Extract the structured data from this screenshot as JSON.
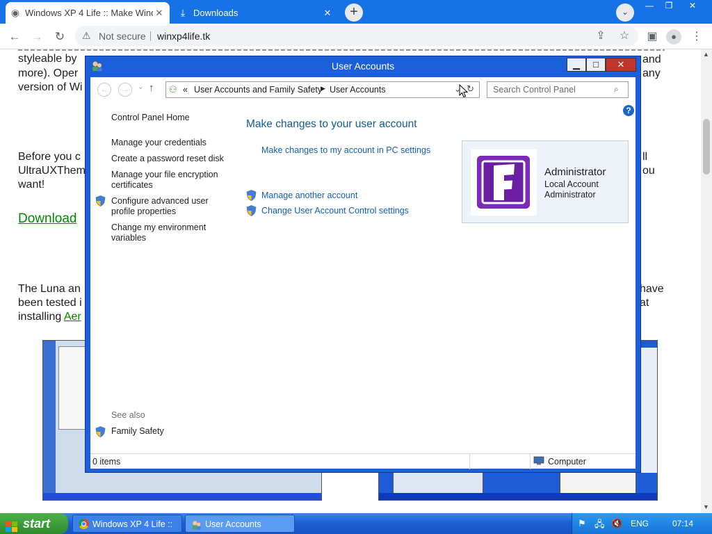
{
  "browser": {
    "tabs": [
      {
        "title": "Windows XP 4 Life :: Make Windo",
        "active": true
      },
      {
        "title": "Downloads",
        "active": false
      }
    ],
    "omnibox": {
      "status": "Not secure",
      "url": "winxp4life.tk"
    }
  },
  "webpage": {
    "lines_left": [
      "styleable by",
      "more).  Oper",
      "version of Wi",
      "Before you c",
      "UltraUXThem",
      "want!",
      "The Luna an",
      "been tested i",
      "installing "
    ],
    "lines_right": [
      "and",
      "any",
      "ll",
      "ou",
      "have",
      "at"
    ],
    "download_link": "Download",
    "aero_link": "Aer"
  },
  "dialog": {
    "title": "User Accounts",
    "breadcrumb": {
      "prefix": "«",
      "items": [
        "User Accounts and Family Safety",
        "User Accounts"
      ]
    },
    "search_placeholder": "Search Control Panel",
    "sidebar": {
      "home": "Control Panel Home",
      "links": [
        "Manage your credentials",
        "Create a password reset disk",
        "Manage your file encryption certificates",
        "Configure advanced user profile properties",
        "Change my environment variables"
      ],
      "see_also_label": "See also",
      "see_also": [
        "Family Safety"
      ]
    },
    "main": {
      "heading": "Make changes to your user account",
      "pc_settings_link": "Make changes to my account in PC settings",
      "tasks": [
        "Manage another account",
        "Change User Account Control settings"
      ]
    },
    "account": {
      "name": "Administrator",
      "type": "Local Account",
      "role": "Administrator",
      "avatar_letter": "F"
    },
    "status": {
      "items": "0 items",
      "location": "Computer"
    }
  },
  "taskbar": {
    "start": "start",
    "tasks": [
      "Windows XP 4 Life :: ...",
      "User Accounts"
    ],
    "tray": {
      "lang": "ENG",
      "time": "07:14"
    }
  },
  "colors": {
    "chrome_blue": "#1573e6",
    "link_blue": "#0f5fb3",
    "avatar_purple": "#7b2bb6",
    "xp_taskbar": "#1d5fd5",
    "start_green": "#2f8a2e"
  }
}
